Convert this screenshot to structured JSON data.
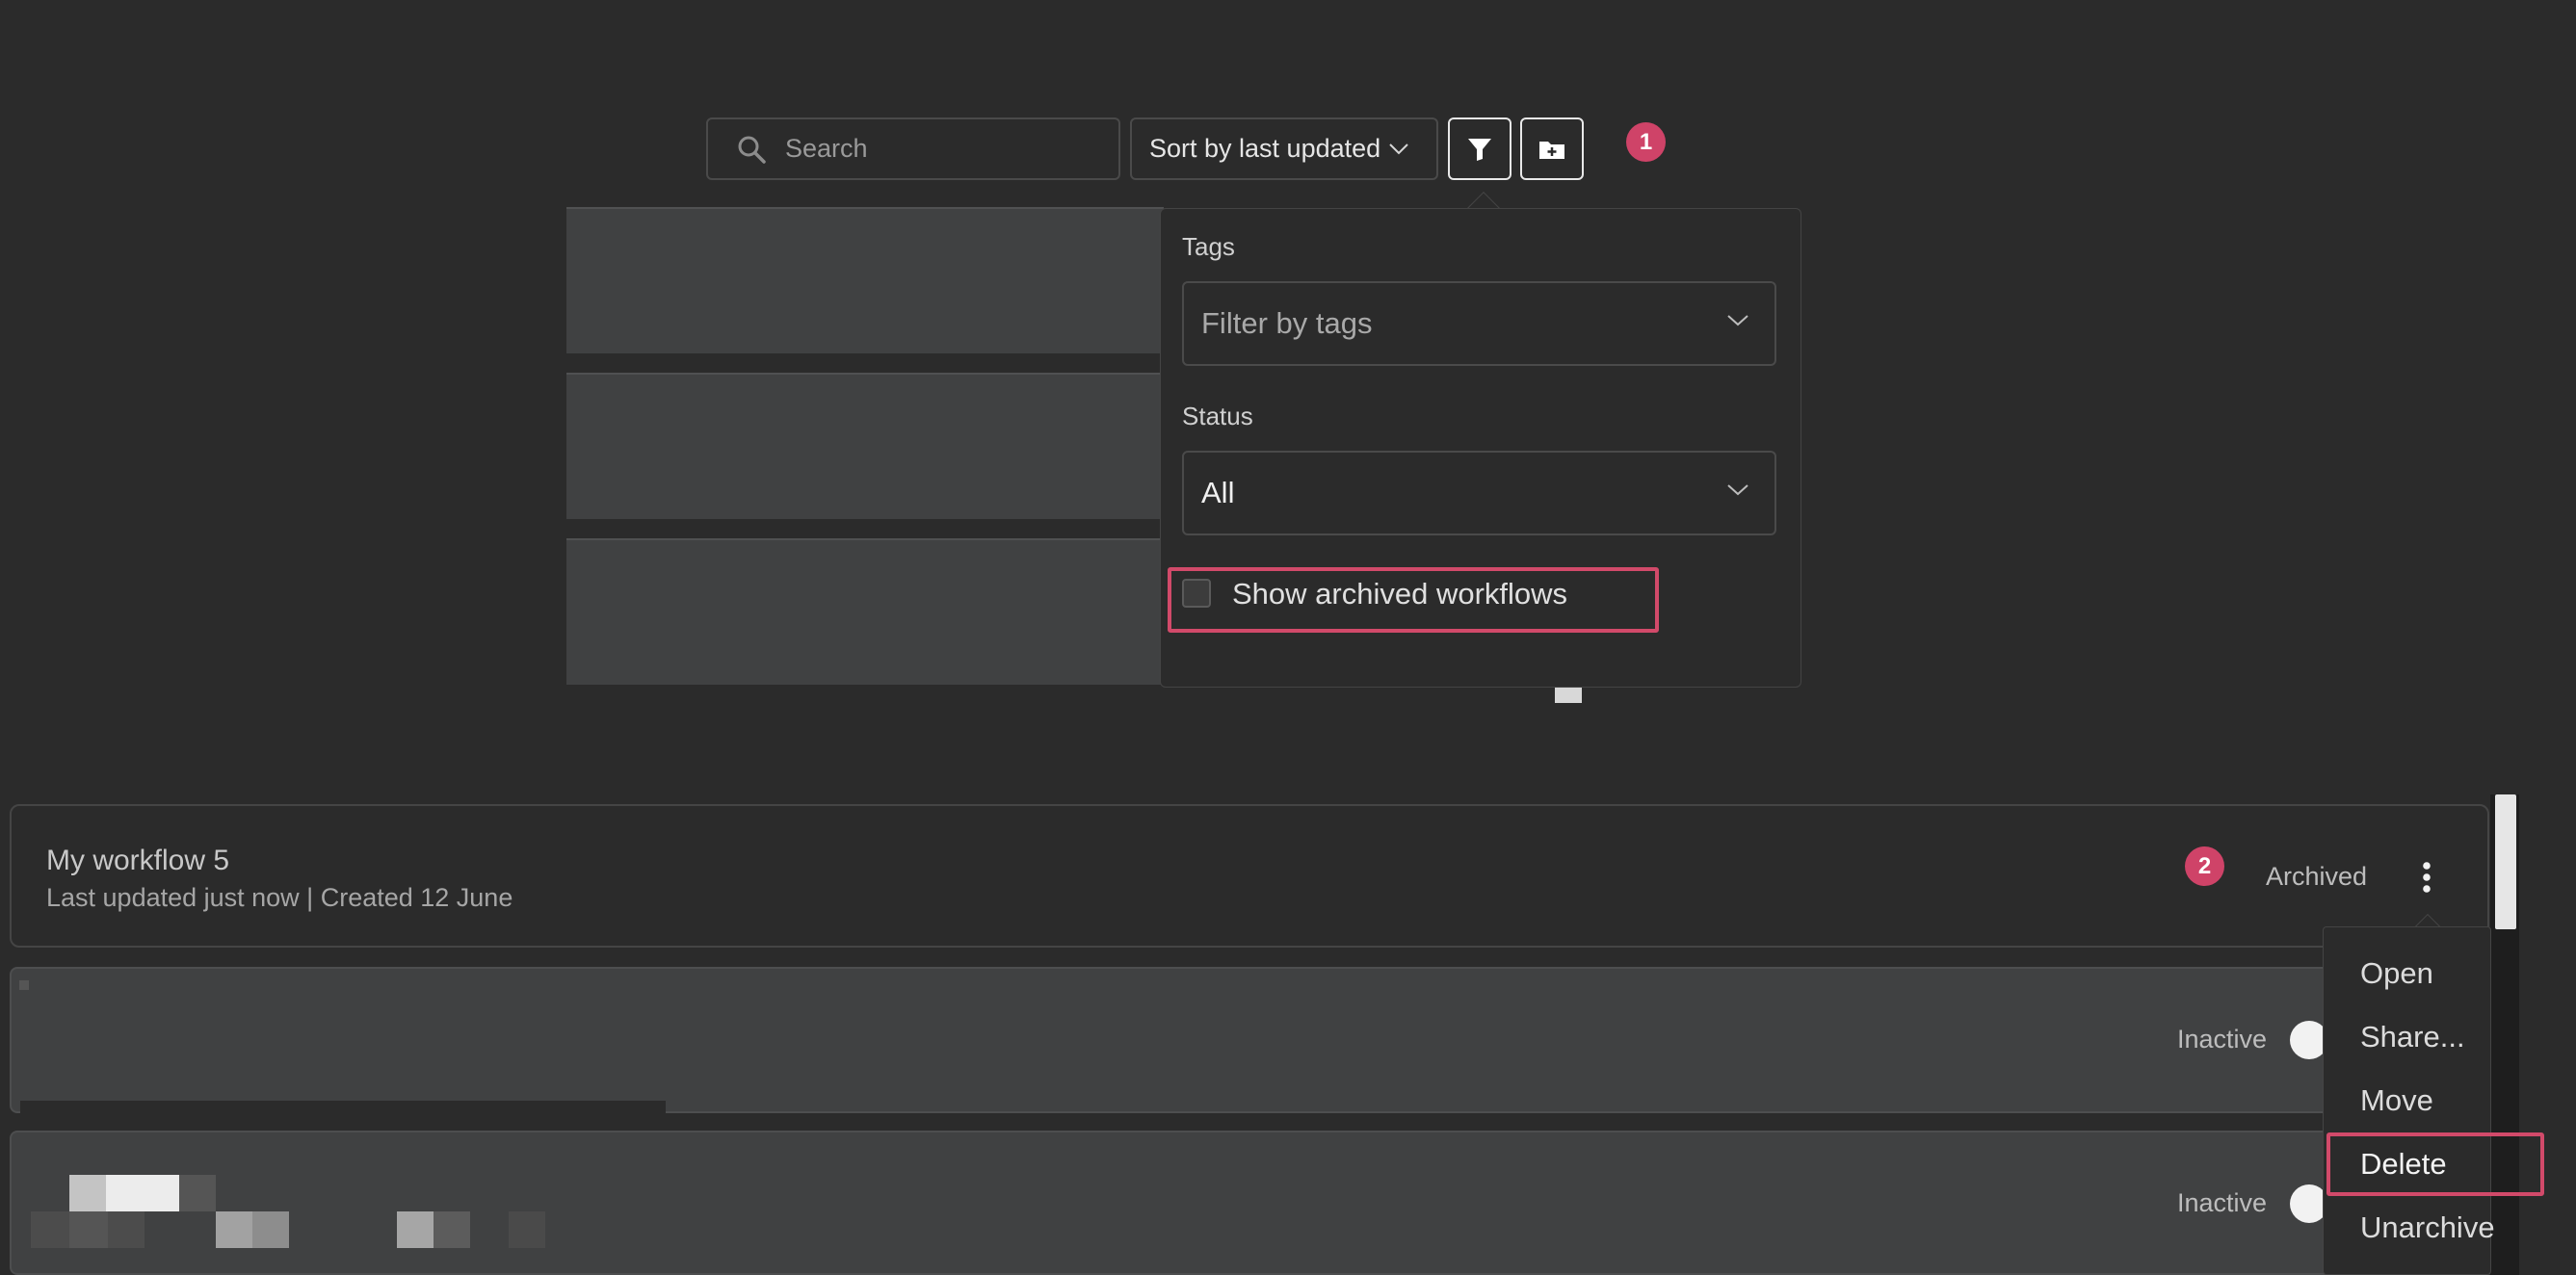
{
  "toolbar": {
    "search_placeholder": "Search",
    "sort_label": "Sort by last updated",
    "step_badge_1": "1"
  },
  "filter_popover": {
    "tags_label": "Tags",
    "tags_placeholder": "Filter by tags",
    "status_label": "Status",
    "status_value": "All",
    "show_archived_label": "Show archived workflows",
    "show_archived_checked": false
  },
  "workflows": {
    "step_badge_2": "2",
    "archived": {
      "title": "My workflow 5",
      "subtitle": "Last updated just now | Created 12 June",
      "status": "Archived"
    },
    "rows": [
      {
        "status": "Inactive"
      },
      {
        "status": "Inactive"
      }
    ]
  },
  "context_menu": {
    "items": [
      "Open",
      "Share...",
      "Move",
      "Delete",
      "Unarchive"
    ]
  },
  "colors": {
    "background": "#2b2b2b",
    "highlight": "#d24a6a",
    "badge": "#cf4368"
  },
  "icons": {
    "search": "search-icon",
    "filter": "funnel-icon",
    "new_folder": "folder-plus-icon",
    "more": "vertical-dots-icon",
    "chevron": "chevron-down-icon"
  }
}
